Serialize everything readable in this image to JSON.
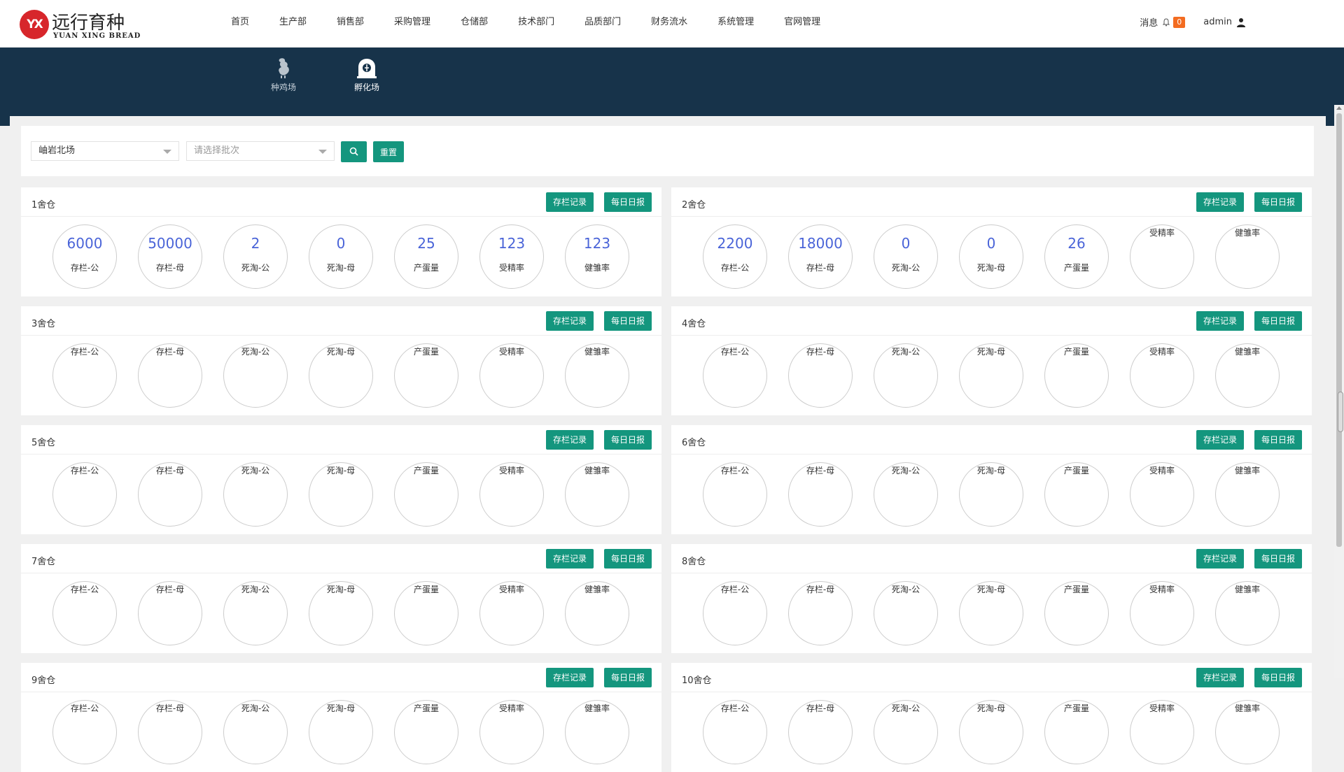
{
  "brand": {
    "logo_mark": "YX",
    "name_cn": "远行育种",
    "name_en": "YUAN XING BREAD"
  },
  "nav": [
    "首页",
    "生产部",
    "销售部",
    "采购管理",
    "仓储部",
    "技术部门",
    "品质部门",
    "财务流水",
    "系统管理",
    "官网管理"
  ],
  "topright": {
    "messages_label": "消息",
    "message_count": "0",
    "username": "admin",
    "icons": [
      "bell-icon",
      "user-icon"
    ]
  },
  "subnav": [
    {
      "label": "种鸡场",
      "icon": "rooster-icon",
      "active": false
    },
    {
      "label": "孵化场",
      "icon": "incubator-icon",
      "active": true
    }
  ],
  "filter": {
    "farm_value": "岫岩北场",
    "batch_placeholder": "请选择批次",
    "search_icon": "search-icon",
    "reset_label": "重置"
  },
  "card_buttons": {
    "record": "存栏记录",
    "daily": "每日日报"
  },
  "metric_labels": [
    "存栏-公",
    "存栏-母",
    "死淘-公",
    "死淘-母",
    "产蛋量",
    "受精率",
    "健雏率"
  ],
  "colors": {
    "primary": "#14967e",
    "band": "#17334a",
    "value": "#4a64d8",
    "badge": "#f36c21",
    "logo": "#d7262b"
  },
  "sheds": [
    {
      "title": "1舍仓",
      "values": [
        "6000",
        "50000",
        "2",
        "0",
        "25",
        "123",
        "123"
      ]
    },
    {
      "title": "2舍仓",
      "values": [
        "2200",
        "18000",
        "0",
        "0",
        "26",
        "",
        ""
      ]
    },
    {
      "title": "3舍仓",
      "values": [
        "",
        "",
        "",
        "",
        "",
        "",
        ""
      ]
    },
    {
      "title": "4舍仓",
      "values": [
        "",
        "",
        "",
        "",
        "",
        "",
        ""
      ]
    },
    {
      "title": "5舍仓",
      "values": [
        "",
        "",
        "",
        "",
        "",
        "",
        ""
      ]
    },
    {
      "title": "6舍仓",
      "values": [
        "",
        "",
        "",
        "",
        "",
        "",
        ""
      ]
    },
    {
      "title": "7舍仓",
      "values": [
        "",
        "",
        "",
        "",
        "",
        "",
        ""
      ]
    },
    {
      "title": "8舍仓",
      "values": [
        "",
        "",
        "",
        "",
        "",
        "",
        ""
      ]
    },
    {
      "title": "9舍仓",
      "values": [
        "",
        "",
        "",
        "",
        "",
        "",
        ""
      ]
    },
    {
      "title": "10舍仓",
      "values": [
        "",
        "",
        "",
        "",
        "",
        "",
        ""
      ]
    }
  ]
}
